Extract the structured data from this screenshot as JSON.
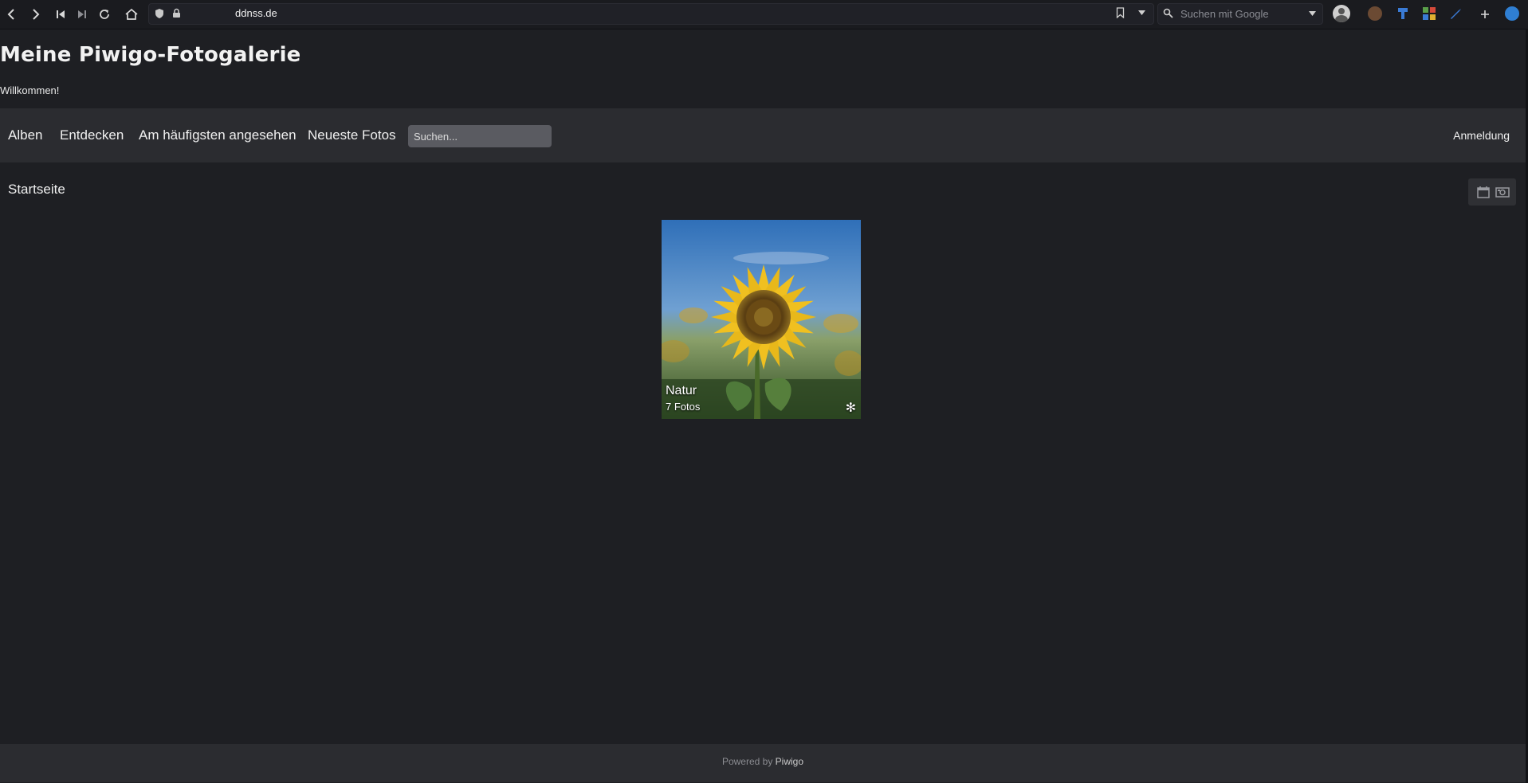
{
  "browser": {
    "url": "ddnss.de",
    "search_placeholder": "Suchen mit Google",
    "icons": {
      "back": "back-icon",
      "forward": "forward-icon",
      "first": "skip-back-icon",
      "last": "skip-forward-icon",
      "reload": "reload-icon",
      "home": "home-icon",
      "shield": "shield-icon",
      "lock": "lock-icon",
      "bookmark": "bookmark-icon",
      "profile": "profile-icon",
      "add": "plus-icon"
    },
    "extension_colors": [
      "#8a6a4a",
      "#3a7bd5",
      "#5aa04a",
      "#3a7bd5",
      "#2f7fd3"
    ]
  },
  "site": {
    "title": "Meine Piwigo-Fotogalerie",
    "subtitle": "Willkommen!"
  },
  "nav": {
    "items": [
      "Alben",
      "Entdecken",
      "Am häufigsten angesehen",
      "Neueste Fotos"
    ],
    "search_placeholder": "Suchen...",
    "login": "Anmeldung"
  },
  "breadcrumb": "Startseite",
  "view_tools": [
    "calendar-icon",
    "camera-icon"
  ],
  "albums": [
    {
      "name": "Natur",
      "count": "7 Fotos",
      "badge": "✻",
      "image": "sunflower"
    }
  ],
  "footer": {
    "prefix": "Powered by",
    "brand": "Piwigo"
  },
  "colors": {
    "page_bg": "#1e1f23",
    "nav_bg": "#2b2c30",
    "text": "#f0f0f0"
  }
}
